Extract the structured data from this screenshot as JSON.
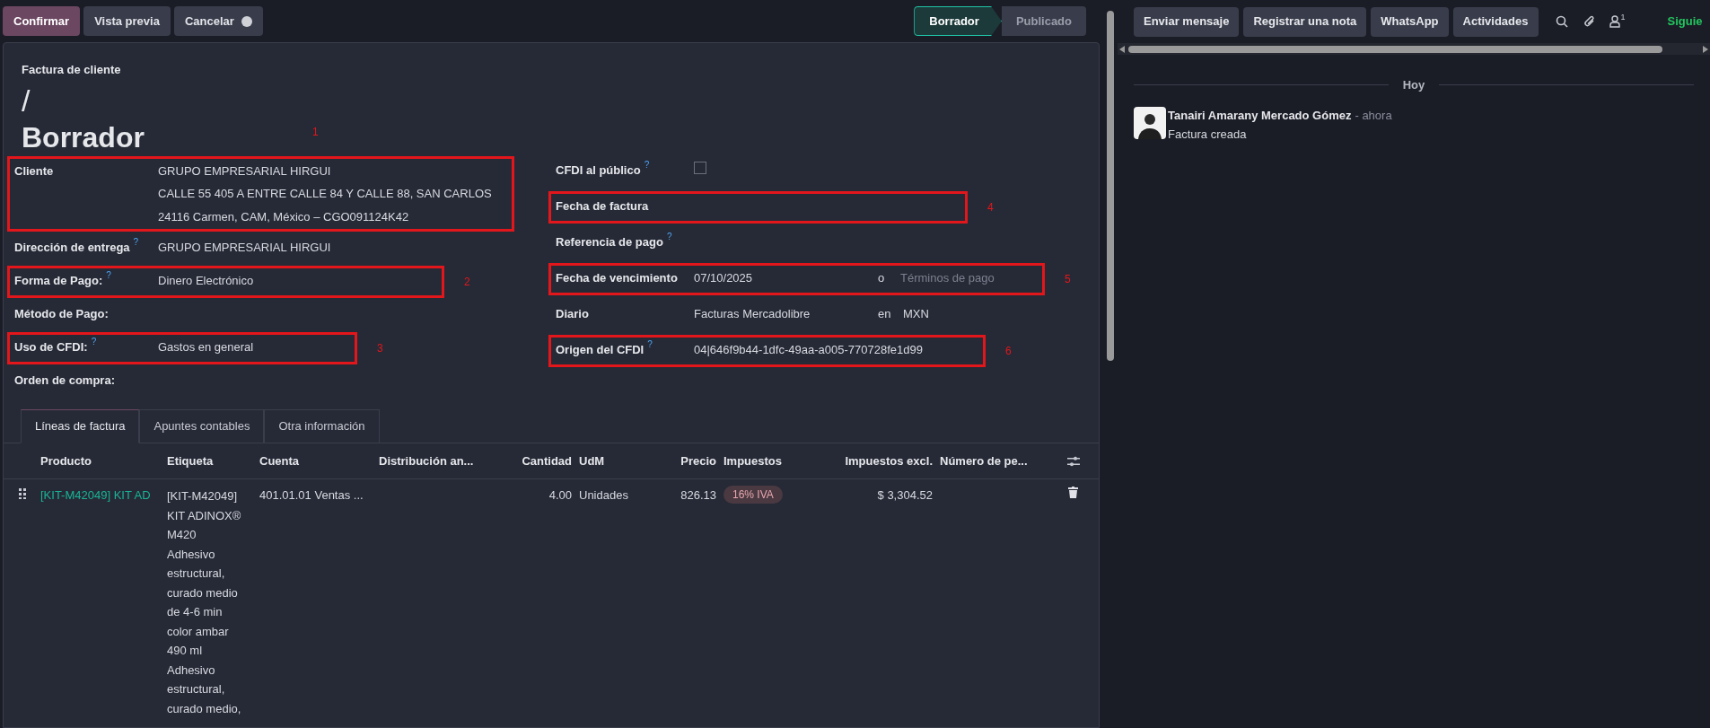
{
  "actions": [
    {
      "label": "Confirmar",
      "primary": true
    },
    {
      "label": "Vista previa",
      "primary": false
    },
    {
      "label": "Cancelar",
      "primary": false
    }
  ],
  "status_steps": [
    {
      "label": "Borrador",
      "selected": true
    },
    {
      "label": "Publicado",
      "selected": false
    }
  ],
  "form": {
    "subtitle": "Factura de cliente",
    "number": "/",
    "state": "Borrador",
    "left": [
      {
        "kind": "text",
        "label": "Cliente",
        "values": [
          "GRUPO EMPRESARIAL HIRGUI",
          "CALLE 55 405 A ENTRE CALLE 84 Y CALLE 88, SAN CARLOS",
          "24116 Carmen, CAM, México – CGO091124K42"
        ],
        "annotation": "1"
      },
      {
        "kind": "text",
        "label": "Dirección de entrega",
        "help": "?",
        "values": [
          "GRUPO EMPRESARIAL HIRGUI"
        ]
      },
      {
        "kind": "text",
        "label": "Forma de Pago:",
        "help": "?",
        "values": [
          "Dinero Electrónico"
        ],
        "annotation": "2"
      },
      {
        "kind": "text",
        "label": "Método de Pago:"
      },
      {
        "kind": "text",
        "label": "Uso de CFDI:",
        "help": "?",
        "values": [
          "Gastos en general"
        ],
        "annotation": "3"
      },
      {
        "kind": "text",
        "label": "Orden de compra:"
      }
    ],
    "right": [
      {
        "kind": "checkbox",
        "label": "CFDI al público",
        "help": "?",
        "checked": false
      },
      {
        "kind": "text",
        "label": "Fecha de factura",
        "annotation": "4"
      },
      {
        "kind": "text",
        "label": "Referencia de pago",
        "help": "?"
      },
      {
        "kind": "due",
        "label": "Fecha de vencimiento",
        "value": "07/10/2025",
        "joiner": "o",
        "placeholder": "Términos de pago",
        "annotation": "5"
      },
      {
        "kind": "journal",
        "label": "Diario",
        "value": "Facturas Mercadolibre",
        "joiner": "en",
        "currency": "MXN"
      },
      {
        "kind": "text",
        "label": "Origen del CFDI",
        "help": "?",
        "values": [
          "04|646f9b44-1dfc-49aa-a005-770728fe1d99"
        ],
        "annotation": "6"
      }
    ]
  },
  "tabs": [
    {
      "label": "Líneas de factura",
      "selected": true
    },
    {
      "label": "Apuntes contables",
      "selected": false
    },
    {
      "label": "Otra información",
      "selected": false
    }
  ],
  "table": {
    "columns": [
      "Producto",
      "Etiqueta",
      "Cuenta",
      "Distribución an...",
      "Cantidad",
      "UdM",
      "Precio",
      "Impuestos",
      "Impuestos excl.",
      "Número de pe..."
    ],
    "rows": [
      {
        "product": "[KIT-M42049] KIT AD",
        "label_lines": [
          "[KIT-M42049]",
          "KIT ADINOX®",
          "M420",
          "Adhesivo",
          "estructural,",
          "curado medio",
          "de 4-6 min",
          "color ambar",
          "490 ml",
          "Adhesivo",
          "estructural,",
          "curado medio,"
        ],
        "account": "401.01.01 Ventas ...",
        "quantity": "4.00",
        "uom": "Unidades",
        "price": "826.13",
        "taxes": [
          "16% IVA"
        ],
        "subtotal": "$ 3,304.52"
      }
    ]
  },
  "chatter": {
    "buttons": [
      "Enviar mensaje",
      "Registrar una nota",
      "WhatsApp",
      "Actividades"
    ],
    "followers_count": "1",
    "follow": "Siguie",
    "date_separator": "Hoy",
    "messages": [
      {
        "author": "Tanairi Amarany Mercado Gómez",
        "time": "- ahora",
        "body": "Factura creada"
      }
    ]
  }
}
